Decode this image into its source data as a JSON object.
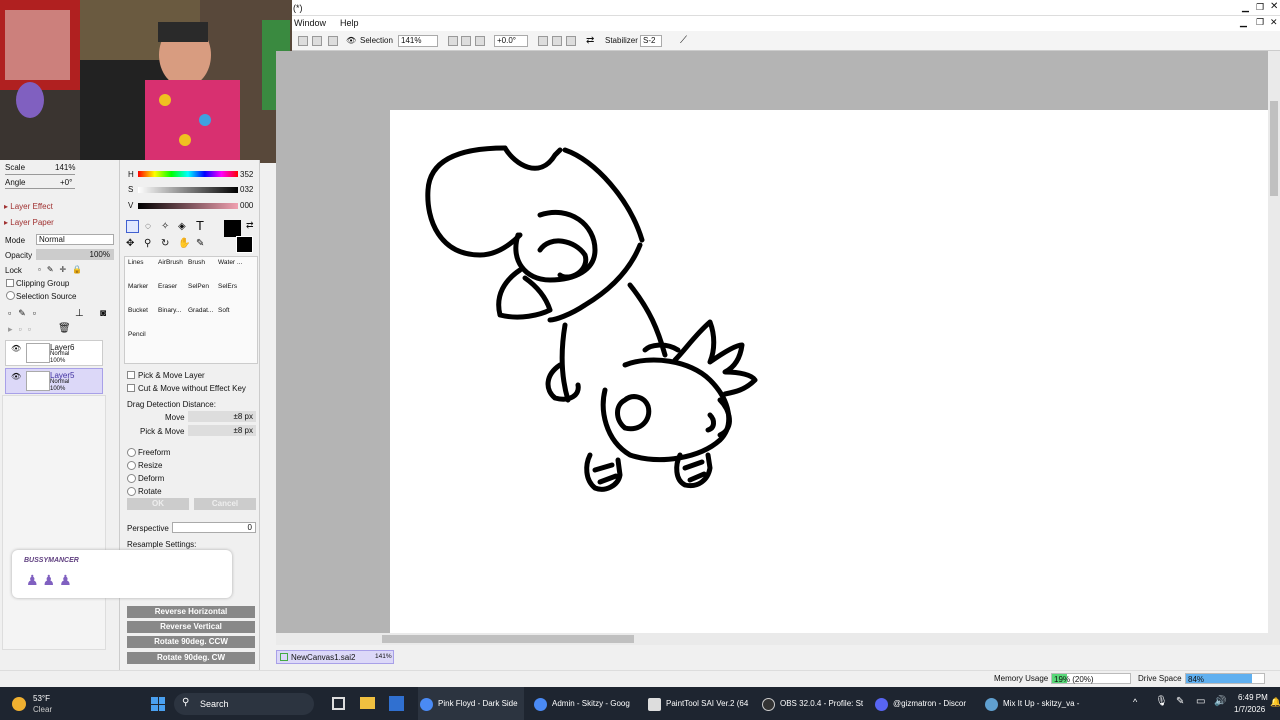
{
  "title": {
    "text": "(*)"
  },
  "menu": {
    "window": "Window",
    "help": "Help"
  },
  "toolbar": {
    "selection_label": "Selection",
    "zoom": "141%",
    "angle": "+0.0°",
    "stabilizer_label": "Stabilizer",
    "stabilizer_value": "S-2"
  },
  "navigator": {
    "scale_label": "Scale",
    "scale_value": "141%",
    "angle_label": "Angle",
    "angle_value": "+0°"
  },
  "layer_panel": {
    "layer_effect": "Layer Effect",
    "layer_paper": "Layer Paper",
    "mode_label": "Mode",
    "mode_value": "Normal",
    "opacity_label": "Opacity",
    "opacity_value": "100%",
    "lock_label": "Lock",
    "clipping_group": "Clipping Group",
    "selection_source": "Selection Source",
    "layers": [
      {
        "name": "Layer6",
        "mode": "Normal",
        "opacity": "100%"
      },
      {
        "name": "Layer5",
        "mode": "Normal",
        "opacity": "100%"
      }
    ]
  },
  "color": {
    "h_label": "H",
    "h_value": "352",
    "s_label": "S",
    "s_value": "032",
    "v_label": "V",
    "v_value": "000"
  },
  "brushes": [
    [
      "Lines",
      "AirBrush",
      "Brush",
      "Water ..."
    ],
    [
      "Marker",
      "Eraser",
      "SelPen",
      "SelErs"
    ],
    [
      "Bucket",
      "Binary...",
      "Gradat...",
      "Soft"
    ],
    [
      "Pencil"
    ]
  ],
  "transform": {
    "pick_move_layer": "Pick & Move Layer",
    "cut_move": "Cut & Move without Effect Key",
    "drag_label": "Drag Detection Distance:",
    "move_label": "Move",
    "move_value": "±8 px",
    "pick_move_label": "Pick & Move",
    "pick_move_value": "±8 px",
    "options": [
      "Freeform",
      "Resize",
      "Deform",
      "Rotate"
    ],
    "ok": "OK",
    "cancel": "Cancel",
    "perspective_label": "Perspective",
    "perspective_value": "0",
    "resample_label": "Resample Settings:",
    "buttons": [
      "Reverse Horizontal",
      "Reverse Vertical",
      "Rotate 90deg. CCW",
      "Rotate 90deg. CW"
    ]
  },
  "overlay": {
    "name": "BUSSYMANCER"
  },
  "document": {
    "name": "NewCanvas1.sai2",
    "zoom": "141%"
  },
  "status": {
    "memory_label": "Memory Usage",
    "memory_value": "19% (20%)",
    "memory_fraction": 0.19,
    "drive_label": "Drive Space",
    "drive_value": "84%",
    "drive_fraction": 0.84
  },
  "taskbar": {
    "weather_temp": "53°F",
    "weather_desc": "Clear",
    "search": "Search",
    "apps": [
      {
        "label": "Pink Floyd - Dark Side",
        "icon": "chrome-icon",
        "color": "#4a8af4"
      },
      {
        "label": "Admin - Skitzy - Goog",
        "icon": "chrome-icon",
        "color": "#4a8af4"
      },
      {
        "label": "PaintTool SAI Ver.2 (64",
        "icon": "painttool-icon",
        "color": "#dddddd"
      },
      {
        "label": "OBS 32.0.4 - Profile: St",
        "icon": "obs-icon",
        "color": "#333333"
      },
      {
        "label": "@gizmatron - Discor",
        "icon": "discord-icon",
        "color": "#5865f2"
      },
      {
        "label": "Mix It Up - skitzy_va -",
        "icon": "mixitup-icon",
        "color": "#60a0d0"
      }
    ],
    "time": "6:49 PM",
    "date": "1/7/2026"
  },
  "colors": {
    "accent": "#3b78d8",
    "hue_bar": "#ff0000",
    "status_green": "#58d878",
    "status_blue": "#60b0f0"
  }
}
